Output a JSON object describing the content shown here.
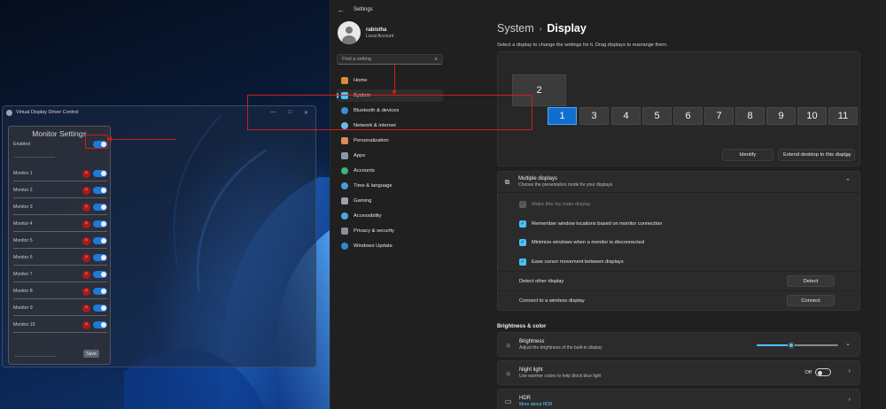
{
  "vdd": {
    "title": "Virtual Display Driver Control",
    "window_controls": [
      "—",
      "□",
      "✕"
    ],
    "panel_title": "Monitor Settings",
    "enabled_label": "Enabled",
    "monitors": [
      "Monitor 1",
      "Monitor 2",
      "Monitor 3",
      "Monitor 4",
      "Monitor 5",
      "Monitor 6",
      "Monitor 7",
      "Monitor 8",
      "Monitor 9",
      "Monitor 10"
    ],
    "save_label": "Save"
  },
  "settings": {
    "window_title": "Settings",
    "user": {
      "name": "rabistha",
      "account": "Local Account"
    },
    "search_placeholder": "Find a setting",
    "nav": [
      {
        "label": "Home",
        "color": "#d98a3a"
      },
      {
        "label": "System",
        "color": "#4cc2ff"
      },
      {
        "label": "Bluetooth & devices",
        "color": "#3a8fd8"
      },
      {
        "label": "Network & internet",
        "color": "#6cb8e6"
      },
      {
        "label": "Personalization",
        "color": "#e08a5a"
      },
      {
        "label": "Apps",
        "color": "#8a96b0"
      },
      {
        "label": "Accounts",
        "color": "#3cb47a"
      },
      {
        "label": "Time & language",
        "color": "#4a9ad8"
      },
      {
        "label": "Gaming",
        "color": "#9aa2ae"
      },
      {
        "label": "Accessibility",
        "color": "#4aa8e0"
      },
      {
        "label": "Privacy & security",
        "color": "#8a8f9a"
      },
      {
        "label": "Windows Update",
        "color": "#2a8ad8"
      }
    ],
    "breadcrumb": {
      "parent": "System",
      "current": "Display"
    },
    "hint": "Select a display to change the settings for it. Drag displays to rearrange them.",
    "monitor_tiles": [
      "2",
      "1",
      "3",
      "4",
      "5",
      "6",
      "7",
      "8",
      "9",
      "10",
      "11"
    ],
    "identify_label": "Identify",
    "extend_label": "Extend desktop to this display",
    "multiple_displays": {
      "title": "Multiple displays",
      "subtitle": "Choose the presentation mode for your displays",
      "options": [
        {
          "label": "Make this my main display",
          "checked": true,
          "disabled": true
        },
        {
          "label": "Remember window locations based on monitor connection",
          "checked": true,
          "disabled": false
        },
        {
          "label": "Minimize windows when a monitor is disconnected",
          "checked": true,
          "disabled": false
        },
        {
          "label": "Ease cursor movement between displays",
          "checked": true,
          "disabled": false
        }
      ],
      "detect_label": "Detect other display",
      "detect_button": "Detect",
      "connect_label": "Connect to a wireless display",
      "connect_button": "Connect"
    },
    "brightness_section": "Brightness & color",
    "brightness": {
      "title": "Brightness",
      "subtitle": "Adjust the brightness of the built-in display",
      "level": 0.42
    },
    "night_light": {
      "title": "Night light",
      "subtitle": "Use warmer colors to help block blue light",
      "state": "Off"
    },
    "hdr": {
      "title": "HDR",
      "subtitle": "More about HDR"
    }
  }
}
